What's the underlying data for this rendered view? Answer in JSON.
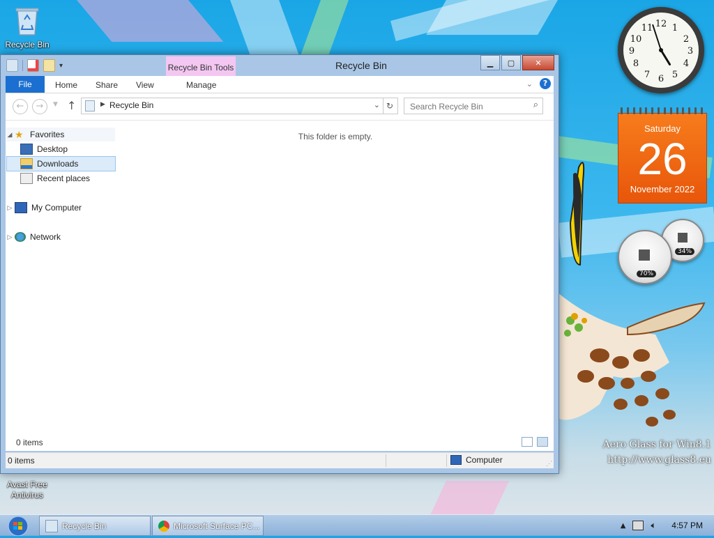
{
  "desktop": {
    "icons": [
      {
        "label": "Recycle Bin",
        "icon": "recycle-bin-icon"
      },
      {
        "label": "Avast Free Antivirus",
        "icon": "avast-icon"
      }
    ],
    "watermark_line1": "Aero Glass for Win8.1",
    "watermark_line2": "http://www.glass8.eu"
  },
  "window": {
    "title": "Recycle Bin",
    "context_tab": "Recycle Bin Tools",
    "ribbon": {
      "file": "File",
      "tabs": [
        "Home",
        "Share",
        "View",
        "Manage"
      ]
    },
    "address": {
      "crumb": "Recycle Bin",
      "search_placeholder": "Search Recycle Bin"
    },
    "nav_pane": {
      "favorites": "Favorites",
      "items": [
        "Desktop",
        "Downloads",
        "Recent places"
      ],
      "my_computer": "My Computer",
      "network": "Network"
    },
    "content": {
      "empty_message": "This folder is empty.",
      "item_count": "0 items"
    },
    "status": {
      "item_count": "0 items",
      "location": "Computer"
    }
  },
  "gadgets": {
    "clock": {
      "hour": 4,
      "minute": 57
    },
    "calendar": {
      "weekday": "Saturday",
      "day": "26",
      "month_year": "November 2022"
    },
    "meters": {
      "cpu": "70%",
      "memory": "34%"
    }
  },
  "taskbar": {
    "buttons": [
      {
        "label": "Recycle Bin",
        "icon": "recycle-bin-icon"
      },
      {
        "label": "Microsoft Surface PC...",
        "icon": "chrome-icon"
      }
    ],
    "time": "4:57 PM"
  },
  "colors": {
    "accent": "#1b6fd0",
    "calendar": "#f0680f",
    "context_tab": "#f3c7f2"
  }
}
